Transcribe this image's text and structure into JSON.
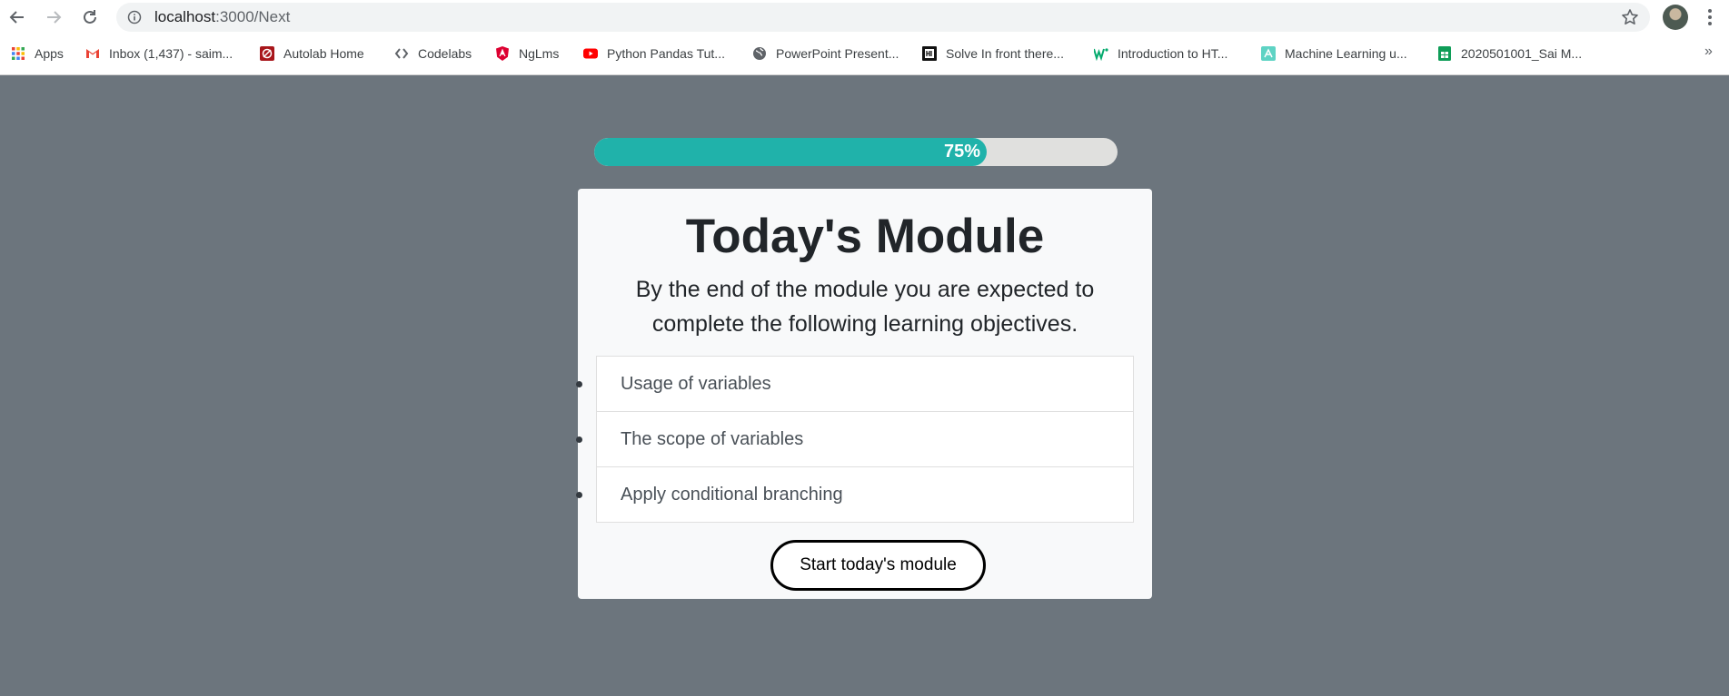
{
  "browser": {
    "url_host": "localhost",
    "url_rest": ":3000/Next",
    "bookmarks": [
      {
        "label": "Apps",
        "icon": "apps-grid-icon"
      },
      {
        "label": "Inbox (1,437) - saim...",
        "icon": "gmail-icon"
      },
      {
        "label": "Autolab Home",
        "icon": "autolab-icon"
      },
      {
        "label": "Codelabs",
        "icon": "codelabs-icon"
      },
      {
        "label": "NgLms",
        "icon": "angular-icon"
      },
      {
        "label": "Python Pandas Tut...",
        "icon": "youtube-icon"
      },
      {
        "label": "PowerPoint Present...",
        "icon": "globe-icon"
      },
      {
        "label": "Solve In front there...",
        "icon": "hackerrank-icon"
      },
      {
        "label": "Introduction to HT...",
        "icon": "w3schools-icon"
      },
      {
        "label": "Machine Learning u...",
        "icon": "ml-icon"
      },
      {
        "label": "2020501001_Sai M...",
        "icon": "sheets-icon"
      }
    ],
    "more_label": "»"
  },
  "progress": {
    "value_percent": 75,
    "label": "75%",
    "fill_color": "#20b2aa",
    "track_color": "#e0e0de"
  },
  "module": {
    "title": "Today's Module",
    "subtitle": "By the end of the module you are expected to complete the following learning objectives.",
    "objectives": [
      "Usage of variables",
      "The scope of variables",
      "Apply conditional branching"
    ],
    "start_label": "Start today's module"
  },
  "colors": {
    "page_background": "#6c757d",
    "card_background": "#f8f9fa"
  }
}
